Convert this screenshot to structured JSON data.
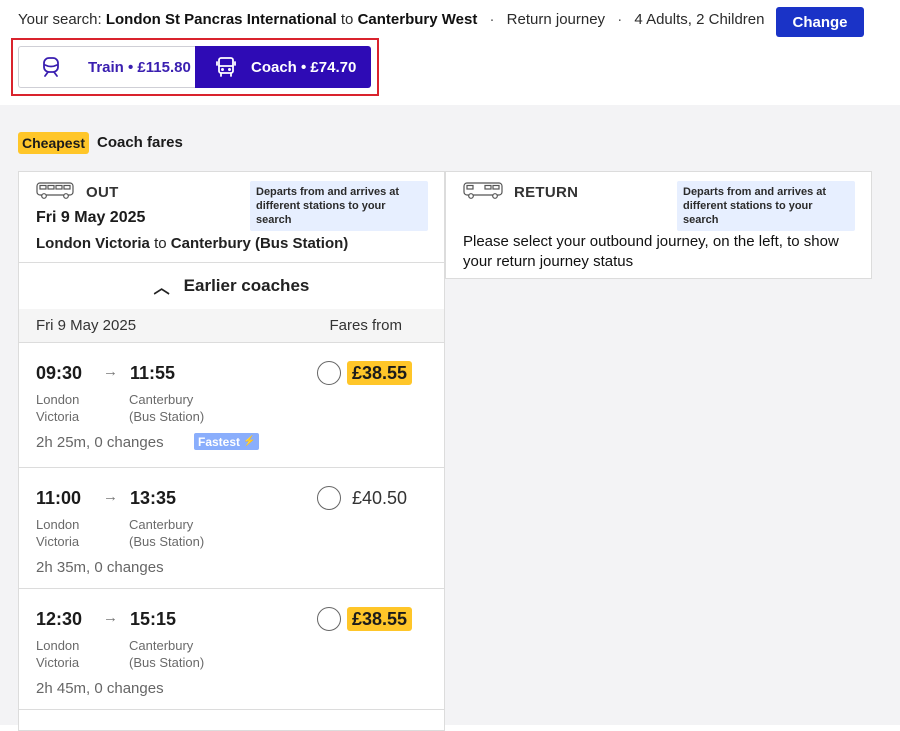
{
  "search": {
    "prefix": "Your search:",
    "origin": "London St Pancras International",
    "to_word": "to",
    "destination": "Canterbury West",
    "journey_type": "Return journey",
    "passengers": "4 Adults, 2 Children",
    "change_label": "Change"
  },
  "modes": [
    {
      "label": "Train • £115.80",
      "icon": "train-icon",
      "selected": false
    },
    {
      "label": "Coach • £74.70",
      "icon": "bus-icon",
      "selected": true
    }
  ],
  "fares": {
    "badge": "Cheapest",
    "title": "Coach fares"
  },
  "outbound": {
    "direction": "OUT",
    "icon": "coach-icon",
    "note": "Departs from and arrives at different stations to your search",
    "date": "Fri 9 May 2025",
    "from": "London Victoria",
    "to_word": "to",
    "to": "Canterbury (Bus Station)",
    "earlier_label": "Earlier coaches",
    "list_date": "Fri 9 May 2025",
    "fares_from": "Fares from",
    "journeys": [
      {
        "dep": "09:30",
        "arr": "11:55",
        "dep_stn_1": "London",
        "dep_stn_2": "Victoria",
        "arr_stn_1": "Canterbury",
        "arr_stn_2": "(Bus Station)",
        "duration": "2h 25m, 0 changes",
        "tag": "Fastest",
        "price": "£38.55",
        "cheapest": true
      },
      {
        "dep": "11:00",
        "arr": "13:35",
        "dep_stn_1": "London",
        "dep_stn_2": "Victoria",
        "arr_stn_1": "Canterbury",
        "arr_stn_2": "(Bus Station)",
        "duration": "2h 35m, 0 changes",
        "tag": "",
        "price": "£40.50",
        "cheapest": false
      },
      {
        "dep": "12:30",
        "arr": "15:15",
        "dep_stn_1": "London",
        "dep_stn_2": "Victoria",
        "arr_stn_1": "Canterbury",
        "arr_stn_2": "(Bus Station)",
        "duration": "2h 45m, 0 changes",
        "tag": "",
        "price": "£38.55",
        "cheapest": true
      }
    ]
  },
  "return": {
    "direction": "RETURN",
    "icon": "coach-icon",
    "note": "Departs from and arrives at different stations to your search",
    "message": "Please select your outbound journey, on the left, to show your return journey status"
  },
  "colors": {
    "brand": "#1a33c7",
    "selected_mode": "#2e0bb5",
    "cheap": "#ffc629",
    "fastest": "#8aaefc",
    "note_bg": "#e7efff",
    "highlight": "#d9232d"
  }
}
